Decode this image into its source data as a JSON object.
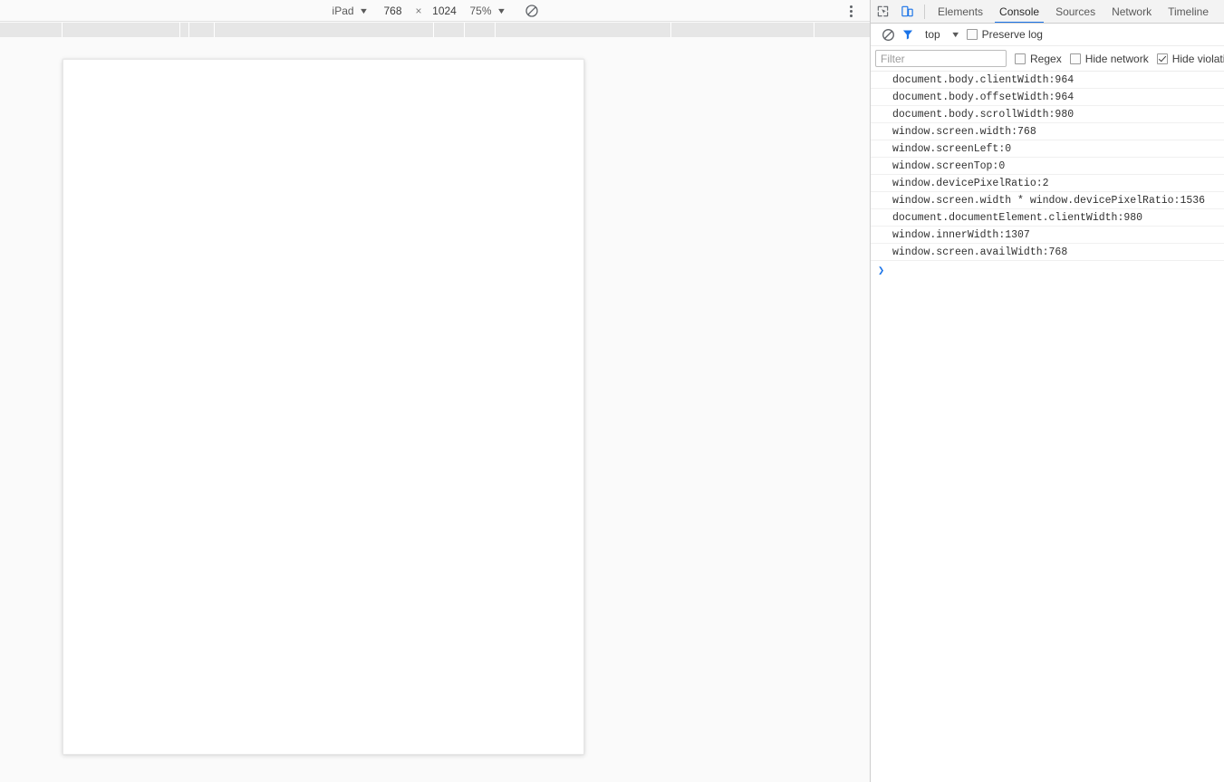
{
  "device_toolbar": {
    "device_name": "iPad",
    "device_caret": "▼",
    "width": "768",
    "separator": "×",
    "height": "1024",
    "zoom": "75%",
    "zoom_caret": "▼",
    "rotate_icon": "rotate-device-icon",
    "menu_icon": "more-options-icon"
  },
  "ruler": {
    "ticks": [
      68,
      198,
      208,
      236,
      478,
      512,
      546,
      740,
      898
    ]
  },
  "viewport": {
    "name": "emulated-page-viewport"
  },
  "devtools": {
    "icons": {
      "inspect": "inspect-element-icon",
      "device": "toggle-device-toolbar-icon"
    },
    "tabs": [
      {
        "label": "Elements",
        "active": false
      },
      {
        "label": "Console",
        "active": true
      },
      {
        "label": "Sources",
        "active": false
      },
      {
        "label": "Network",
        "active": false
      },
      {
        "label": "Timeline",
        "active": false
      }
    ],
    "console_toolbar": {
      "clear_icon": "clear-console-icon",
      "filter_icon": "filter-funnel-icon",
      "context": "top",
      "context_caret": "▼",
      "preserve_log": {
        "label": "Preserve log",
        "checked": false
      }
    },
    "filter_row": {
      "filter_placeholder": "Filter",
      "filter_value": "",
      "regex": {
        "label": "Regex",
        "checked": false
      },
      "hide_network": {
        "label": "Hide network",
        "checked": false
      },
      "hide_violations": {
        "label": "Hide violations",
        "checked": true
      }
    },
    "messages": [
      "document.body.clientWidth:964",
      "document.body.offsetWidth:964",
      "document.body.scrollWidth:980",
      "window.screen.width:768",
      "window.screenLeft:0",
      "window.screenTop:0",
      "window.devicePixelRatio:2",
      "window.screen.width * window.devicePixelRatio:1536",
      "document.documentElement.clientWidth:980",
      "window.innerWidth:1307",
      "window.screen.availWidth:768"
    ],
    "prompt_symbol": "❯"
  }
}
